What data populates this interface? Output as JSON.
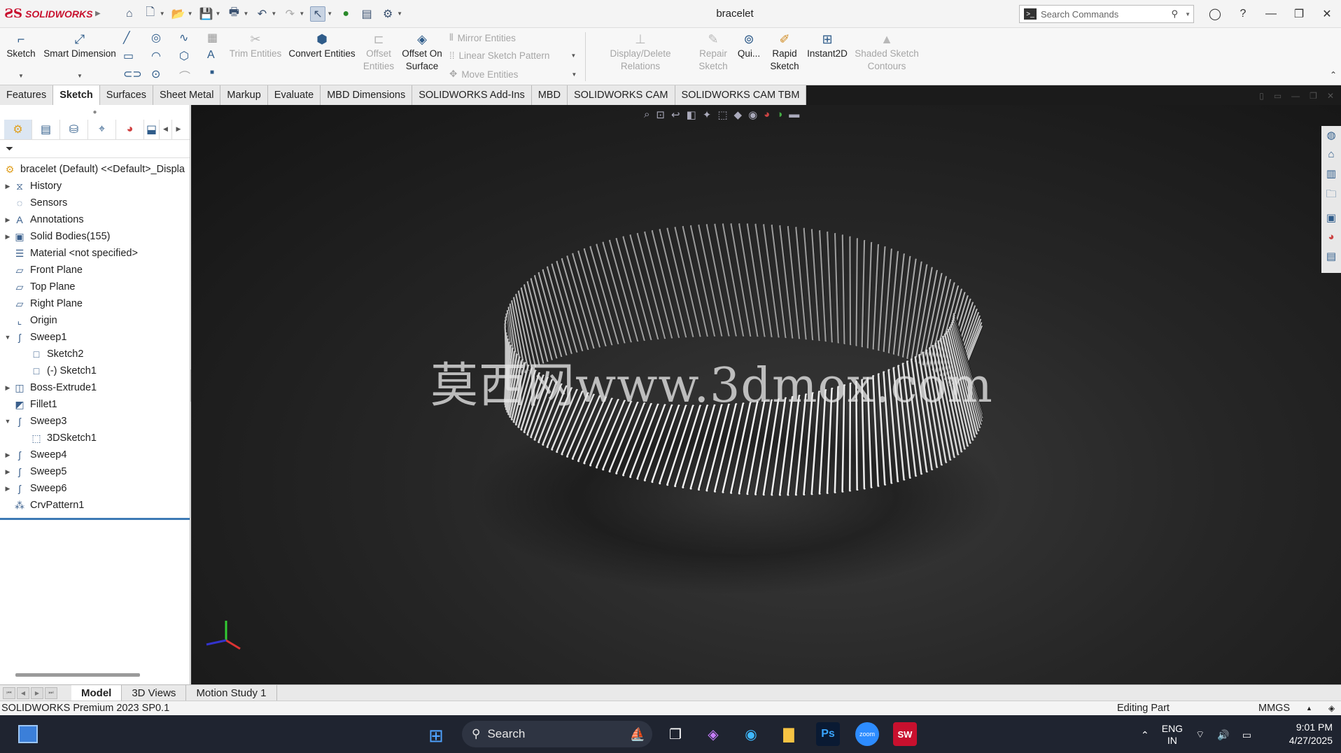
{
  "app": {
    "brand": "SOLIDWORKS",
    "document_title": "bracelet"
  },
  "search": {
    "placeholder": "Search Commands"
  },
  "ribbon": {
    "sketch": "Sketch",
    "smart_dimension": "Smart Dimension",
    "trim_entities": "Trim Entities",
    "convert_entities": "Convert Entities",
    "offset_entities": "Offset Entities",
    "offset_on_surface": "Offset On Surface",
    "mirror_entities": "Mirror Entities",
    "linear_sketch_pattern": "Linear Sketch Pattern",
    "move_entities": "Move Entities",
    "display_delete_relations": "Display/Delete Relations",
    "repair_sketch": "Repair Sketch",
    "quick_snaps": "Qui...",
    "rapid_sketch": "Rapid Sketch",
    "instant2d": "Instant2D",
    "shaded_sketch_contours": "Shaded Sketch Contours"
  },
  "tabs": [
    "Features",
    "Sketch",
    "Surfaces",
    "Sheet Metal",
    "Markup",
    "Evaluate",
    "MBD Dimensions",
    "SOLIDWORKS Add-Ins",
    "MBD",
    "SOLIDWORKS CAM",
    "SOLIDWORKS CAM TBM"
  ],
  "active_tab": "Sketch",
  "tree": {
    "root": "bracelet (Default) <<Default>_Displa",
    "items": [
      {
        "label": "History",
        "icon": "history-icon",
        "expander": "collapsed",
        "level": 0
      },
      {
        "label": "Sensors",
        "icon": "sensor-icon",
        "expander": "none",
        "level": 0
      },
      {
        "label": "Annotations",
        "icon": "annotation-icon",
        "expander": "collapsed",
        "level": 0
      },
      {
        "label": "Solid Bodies(155)",
        "icon": "solid-bodies-icon",
        "expander": "collapsed",
        "level": 0
      },
      {
        "label": "Material <not specified>",
        "icon": "material-icon",
        "expander": "none",
        "level": 0
      },
      {
        "label": "Front Plane",
        "icon": "plane-icon",
        "expander": "none",
        "level": 0
      },
      {
        "label": "Top Plane",
        "icon": "plane-icon",
        "expander": "none",
        "level": 0
      },
      {
        "label": "Right Plane",
        "icon": "plane-icon",
        "expander": "none",
        "level": 0
      },
      {
        "label": "Origin",
        "icon": "origin-icon",
        "expander": "none",
        "level": 0
      },
      {
        "label": "Sweep1",
        "icon": "sweep-icon",
        "expander": "expanded",
        "level": 0
      },
      {
        "label": "Sketch2",
        "icon": "sketch-icon",
        "expander": "none",
        "level": 1
      },
      {
        "label": "(-) Sketch1",
        "icon": "sketch-icon",
        "expander": "none",
        "level": 1
      },
      {
        "label": "Boss-Extrude1",
        "icon": "extrude-icon",
        "expander": "collapsed",
        "level": 0
      },
      {
        "label": "Fillet1",
        "icon": "fillet-icon",
        "expander": "none",
        "level": 0
      },
      {
        "label": "Sweep3",
        "icon": "sweep-icon",
        "expander": "expanded",
        "level": 0
      },
      {
        "label": "3DSketch1",
        "icon": "3dsketch-icon",
        "expander": "none",
        "level": 1
      },
      {
        "label": "Sweep4",
        "icon": "sweep-icon",
        "expander": "collapsed",
        "level": 0
      },
      {
        "label": "Sweep5",
        "icon": "sweep-icon",
        "expander": "collapsed",
        "level": 0
      },
      {
        "label": "Sweep6",
        "icon": "sweep-icon",
        "expander": "collapsed",
        "level": 0
      },
      {
        "label": "CrvPattern1",
        "icon": "curve-pattern-icon",
        "expander": "none",
        "level": 0
      }
    ]
  },
  "viewport": {
    "watermark": "莫西网www.3dmox.com"
  },
  "bottom_tabs": [
    "Model",
    "3D Views",
    "Motion Study 1"
  ],
  "status": {
    "version": "SOLIDWORKS Premium 2023 SP0.1",
    "mode": "Editing Part",
    "units": "MMGS"
  },
  "taskbar": {
    "search": "Search",
    "lang_top": "ENG",
    "lang_bottom": "IN",
    "time": "9:01 PM",
    "date": "4/27/2025",
    "sw_badge": "SW",
    "ps_badge": "Ps",
    "zoom_badge": "zoom"
  },
  "colors": {
    "accent": "#c8102e",
    "selection_blue": "#3d7ab5"
  }
}
